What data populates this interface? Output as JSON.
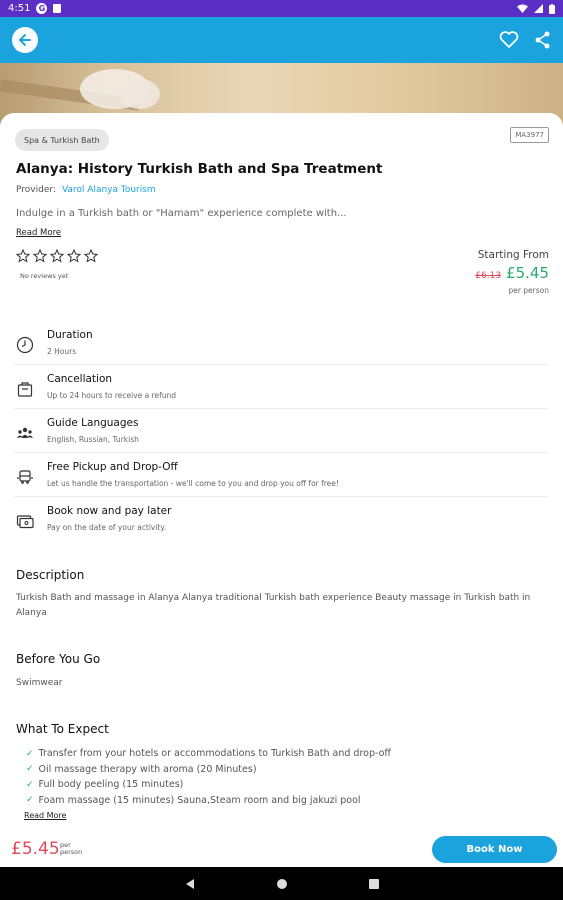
{
  "status_bar": {
    "time": "4:51",
    "g_label": "G"
  },
  "hero": {
    "colors": {
      "accent": "#1ba3dd",
      "status": "#5b2fc6"
    }
  },
  "tour": {
    "category": "Spa & Turkish Bath",
    "code": "MA3977",
    "title": "Alanya: History Turkish Bath and Spa Treatment",
    "provider_label": "Provider:",
    "provider_name": "Varol Alanya Tourism",
    "intro": "Indulge in a Turkish bath or \"Hamam\" experience complete with...",
    "read_more": "Read More",
    "rating_count": 5,
    "no_reviews": "No reviews yet"
  },
  "pricing": {
    "starting_label": "Starting From",
    "old_price": "£6.13",
    "new_price": "£5.45",
    "per_person": "per person"
  },
  "features": [
    {
      "icon": "clock-icon",
      "title": "Duration",
      "desc": "2 Hours"
    },
    {
      "icon": "bag-icon",
      "title": "Cancellation",
      "desc": "Up to 24 hours to receive a refund"
    },
    {
      "icon": "people-icon",
      "title": "Guide Languages",
      "desc": "English, Russian, Turkish"
    },
    {
      "icon": "bus-icon",
      "title": "Free Pickup and Drop-Off",
      "desc": "Let us handle the transportation - we'll come to you and drop you off for free!"
    },
    {
      "icon": "wallet-icon",
      "title": "Book now and pay later",
      "desc": "Pay on the date of your activity."
    }
  ],
  "description": {
    "heading": "Description",
    "text": "Turkish Bath and massage in Alanya Alanya traditional Turkish bath experience Beauty massage in Turkish bath in Alanya"
  },
  "before_you_go": {
    "heading": "Before You Go",
    "text": "Swimwear"
  },
  "what_to_expect": {
    "heading": "What To Expect",
    "items": [
      "Transfer from your hotels or accommodations to Turkish Bath and drop-off",
      "Oil massage therapy with aroma (20 Minutes)",
      "Full body peeling (15 minutes)",
      "Foam massage (15 minutes) Sauna,Steam room and big jakuzi pool"
    ],
    "read_more": "Read More"
  },
  "bottom_bar": {
    "price": "£5.45",
    "per_line1": "per",
    "per_line2": "person",
    "book_label": "Book Now"
  }
}
